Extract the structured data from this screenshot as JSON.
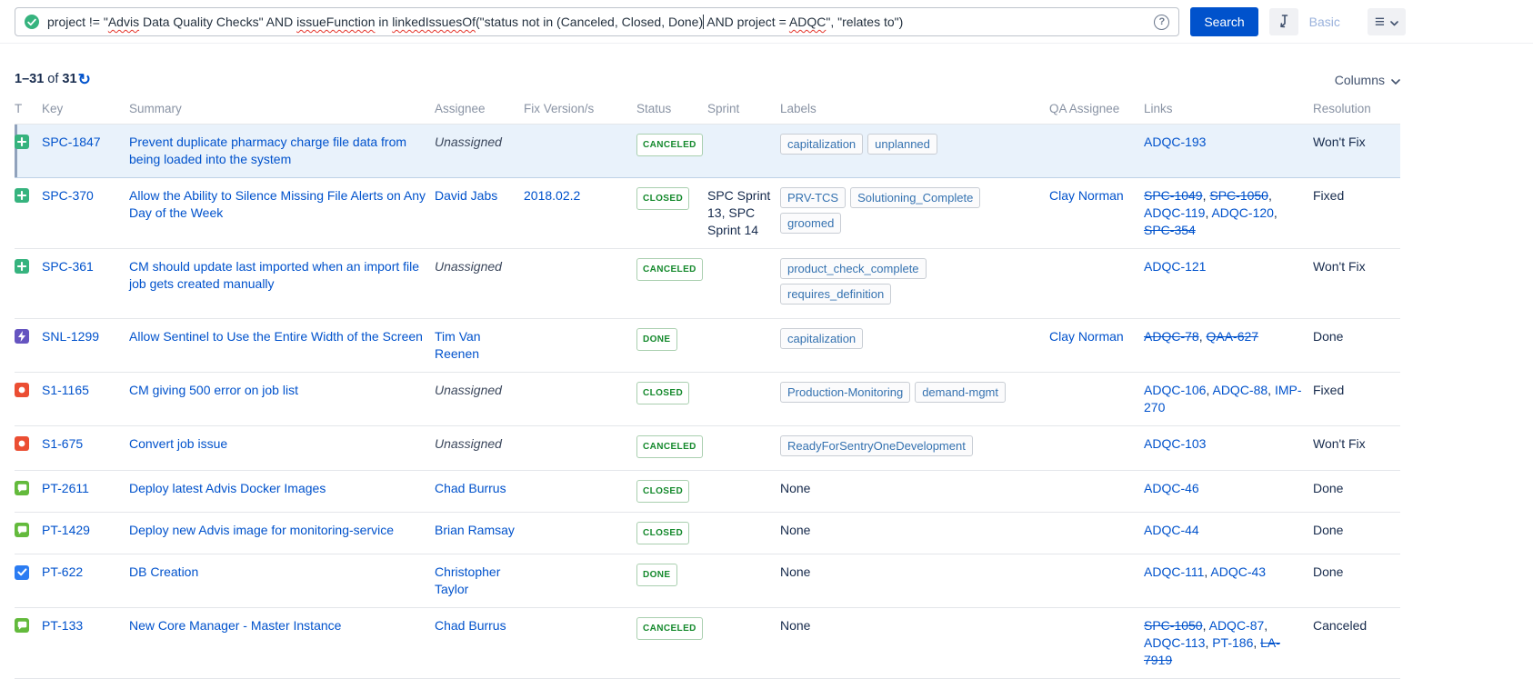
{
  "search_bar": {
    "query_segments": [
      {
        "text": "project != \"",
        "misspelled": false
      },
      {
        "text": "Advis",
        "misspelled": true
      },
      {
        "text": " Data Quality Checks\" AND ",
        "misspelled": false
      },
      {
        "text": "issueFunction",
        "misspelled": true
      },
      {
        "text": " in ",
        "misspelled": false
      },
      {
        "text": "linkedIssuesOf",
        "misspelled": true
      },
      {
        "text": "(\"status not in (Canceled, Closed, Done)",
        "misspelled": false,
        "caret_after": true
      },
      {
        "text": " AND project = ",
        "misspelled": false
      },
      {
        "text": "ADQC",
        "misspelled": true
      },
      {
        "text": "\", \"relates to\")",
        "misspelled": false
      }
    ],
    "help_icon": "?",
    "search_label": "Search",
    "basic_label": "Basic"
  },
  "results": {
    "range": "1–31",
    "of_label": "of",
    "total": "31",
    "columns_label": "Columns"
  },
  "issue_types": {
    "new-feature": {
      "color": "#36B37E",
      "glyph": "plus"
    },
    "epic": {
      "color": "#6554C0",
      "glyph": "bolt"
    },
    "bug": {
      "color": "#EB4E33",
      "glyph": "dot"
    },
    "story": {
      "color": "#63BA3C",
      "glyph": "bubble"
    },
    "task": {
      "color": "#2B7CF2",
      "glyph": "check"
    }
  },
  "colors": {
    "link": "#0052CC",
    "status_green": "#14892C",
    "selected_row_bg": "#E9F2FB",
    "search_button": "#0052CC"
  },
  "table": {
    "headers": [
      "T",
      "Key",
      "Summary",
      "Assignee",
      "Fix Version/s",
      "Status",
      "Sprint",
      "Labels",
      "QA Assignee",
      "Links",
      "Resolution"
    ],
    "none_label": "None",
    "rows": [
      {
        "type": "new-feature",
        "key": "SPC-1847",
        "summary": "Prevent duplicate pharmacy charge file data from being loaded into the system",
        "assignee": "Unassigned",
        "assignee_link": false,
        "fix_version": "",
        "status": "CANCELED",
        "sprint": "",
        "labels": [
          "capitalization",
          "unplanned"
        ],
        "qa_assignee": "",
        "links": [
          {
            "text": "ADQC-193",
            "struck": false
          }
        ],
        "resolution": "Won't Fix",
        "selected": true
      },
      {
        "type": "new-feature",
        "key": "SPC-370",
        "summary": "Allow the Ability to Silence Missing File Alerts on Any Day of the Week",
        "assignee": "David Jabs",
        "assignee_link": true,
        "fix_version": "2018.02.2",
        "status": "CLOSED",
        "sprint": "SPC Sprint 13, SPC Sprint 14",
        "labels": [
          "PRV-TCS",
          "Solutioning_Complete",
          "groomed"
        ],
        "qa_assignee": "Clay Norman",
        "links": [
          {
            "text": "SPC-1049",
            "struck": true
          },
          {
            "text": "SPC-1050",
            "struck": true
          },
          {
            "text": "ADQC-119",
            "struck": false
          },
          {
            "text": "ADQC-120",
            "struck": false
          },
          {
            "text": "SPC-354",
            "struck": true
          }
        ],
        "resolution": "Fixed",
        "selected": false
      },
      {
        "type": "new-feature",
        "key": "SPC-361",
        "summary": "CM should update last imported when an import file job gets created manually",
        "assignee": "Unassigned",
        "assignee_link": false,
        "fix_version": "",
        "status": "CANCELED",
        "sprint": "",
        "labels": [
          "product_check_complete",
          "requires_definition"
        ],
        "qa_assignee": "",
        "links": [
          {
            "text": "ADQC-121",
            "struck": false
          }
        ],
        "resolution": "Won't Fix",
        "selected": false
      },
      {
        "type": "epic",
        "key": "SNL-1299",
        "summary": "Allow Sentinel to Use the Entire Width of the Screen",
        "assignee": "Tim Van Reenen",
        "assignee_link": true,
        "fix_version": "",
        "status": "DONE",
        "sprint": "",
        "labels": [
          "capitalization"
        ],
        "qa_assignee": "Clay Norman",
        "links": [
          {
            "text": "ADQC-78",
            "struck": true
          },
          {
            "text": "QAA-627",
            "struck": true
          }
        ],
        "resolution": "Done",
        "selected": false
      },
      {
        "type": "bug",
        "key": "S1-1165",
        "summary": "CM giving 500 error on job list",
        "assignee": "Unassigned",
        "assignee_link": false,
        "fix_version": "",
        "status": "CLOSED",
        "sprint": "",
        "labels": [
          "Production-Monitoring",
          "demand-mgmt"
        ],
        "qa_assignee": "",
        "links": [
          {
            "text": "ADQC-106",
            "struck": false
          },
          {
            "text": "ADQC-88",
            "struck": false
          },
          {
            "text": "IMP-270",
            "struck": false
          }
        ],
        "resolution": "Fixed",
        "selected": false
      },
      {
        "type": "bug",
        "key": "S1-675",
        "summary": "Convert job issue",
        "assignee": "Unassigned",
        "assignee_link": false,
        "fix_version": "",
        "status": "CANCELED",
        "sprint": "",
        "labels": [
          "ReadyForSentryOneDevelopment"
        ],
        "qa_assignee": "",
        "links": [
          {
            "text": "ADQC-103",
            "struck": false
          }
        ],
        "resolution": "Won't Fix",
        "selected": false
      },
      {
        "type": "story",
        "key": "PT-2611",
        "summary": "Deploy latest Advis Docker Images",
        "assignee": "Chad Burrus",
        "assignee_link": true,
        "fix_version": "",
        "status": "CLOSED",
        "sprint": "",
        "labels": [],
        "qa_assignee": "",
        "links": [
          {
            "text": "ADQC-46",
            "struck": false
          }
        ],
        "resolution": "Done",
        "selected": false
      },
      {
        "type": "story",
        "key": "PT-1429",
        "summary": "Deploy new Advis image for monitoring-service",
        "assignee": "Brian Ramsay",
        "assignee_link": true,
        "fix_version": "",
        "status": "CLOSED",
        "sprint": "",
        "labels": [],
        "qa_assignee": "",
        "links": [
          {
            "text": "ADQC-44",
            "struck": false
          }
        ],
        "resolution": "Done",
        "selected": false
      },
      {
        "type": "task",
        "key": "PT-622",
        "summary": "DB Creation",
        "assignee": "Christopher Taylor",
        "assignee_link": true,
        "fix_version": "",
        "status": "DONE",
        "sprint": "",
        "labels": [],
        "qa_assignee": "",
        "links": [
          {
            "text": "ADQC-111",
            "struck": false
          },
          {
            "text": "ADQC-43",
            "struck": false
          }
        ],
        "resolution": "Done",
        "selected": false
      },
      {
        "type": "story",
        "key": "PT-133",
        "summary": "New Core Manager - Master Instance",
        "assignee": "Chad Burrus",
        "assignee_link": true,
        "fix_version": "",
        "status": "CANCELED",
        "sprint": "",
        "labels": [],
        "qa_assignee": "",
        "links": [
          {
            "text": "SPC-1050",
            "struck": true
          },
          {
            "text": "ADQC-87",
            "struck": false
          },
          {
            "text": "ADQC-113",
            "struck": false
          },
          {
            "text": "PT-186",
            "struck": false
          },
          {
            "text": "LA-7919",
            "struck": true
          }
        ],
        "resolution": "Canceled",
        "selected": false
      }
    ]
  }
}
